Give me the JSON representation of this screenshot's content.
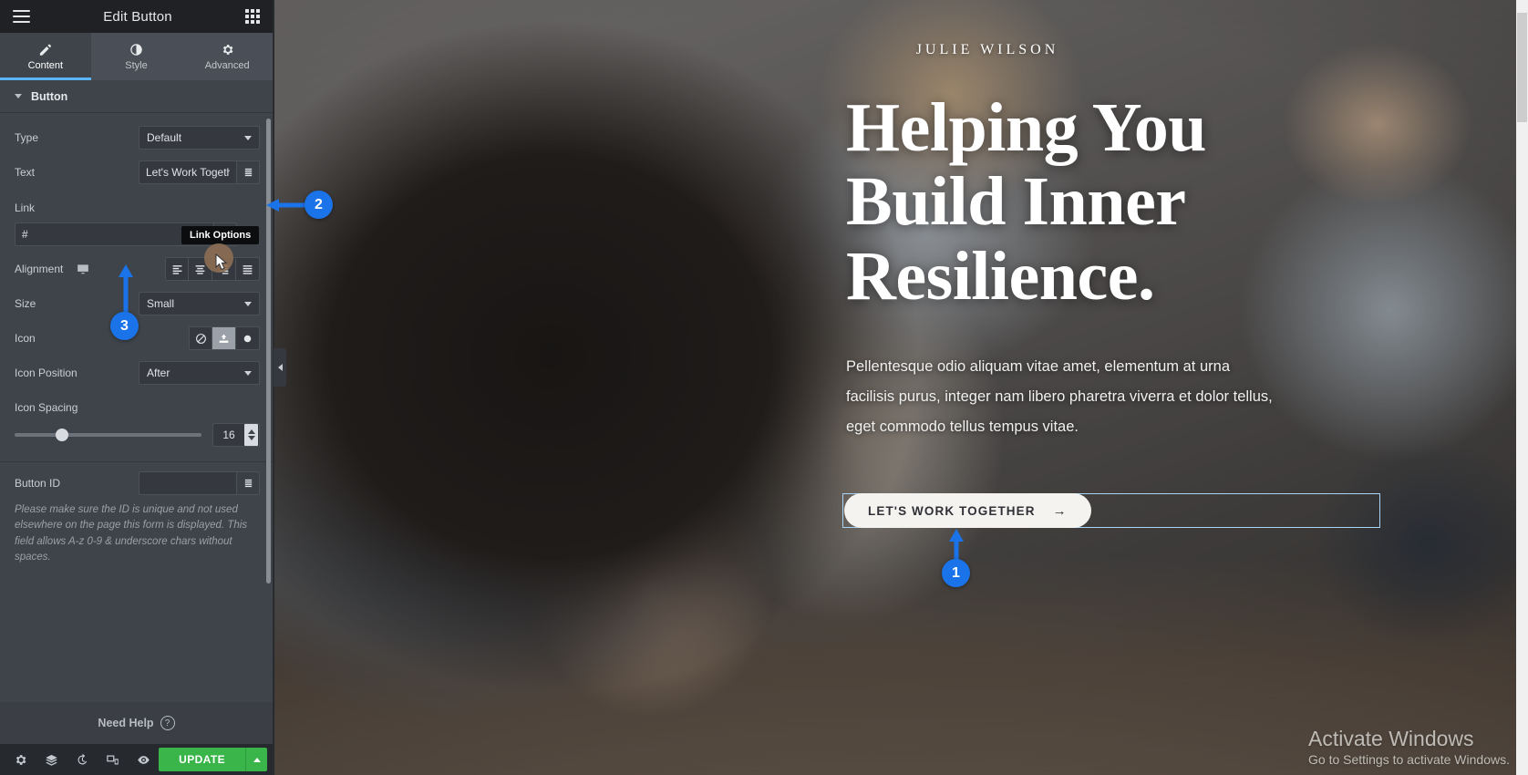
{
  "panel": {
    "header": {
      "title": "Edit Button",
      "menu_icon": "hamburger-icon",
      "apps_icon": "grid-apps-icon"
    },
    "tabs": [
      {
        "id": "content",
        "label": "Content",
        "icon": "pencil-icon",
        "active": true
      },
      {
        "id": "style",
        "label": "Style",
        "icon": "contrast-half-circle-icon",
        "active": false
      },
      {
        "id": "advanced",
        "label": "Advanced",
        "icon": "gear-icon",
        "active": false
      }
    ],
    "section": {
      "title": "Button",
      "collapse_icon": "caret-down-icon"
    },
    "controls": {
      "type": {
        "label": "Type",
        "value": "Default"
      },
      "text": {
        "label": "Text",
        "value": "Let's Work Togethe",
        "dynamic_icon": "dynamic-tags-icon"
      },
      "link": {
        "label": "Link",
        "value": "#",
        "placeholder": "",
        "dynamic_icon": "dynamic-tags-icon",
        "tooltip": "Link Options"
      },
      "alignment": {
        "label": "Alignment",
        "device_icon": "desktop-icon",
        "options": [
          "align-left",
          "align-center",
          "align-right",
          "align-justify"
        ],
        "selected": ""
      },
      "size": {
        "label": "Size",
        "value": "Small"
      },
      "icon": {
        "label": "Icon",
        "options": [
          "none-icon",
          "media-upload-icon",
          "circle-filled-icon"
        ],
        "selected_index": 1
      },
      "icon_position": {
        "label": "Icon Position",
        "value": "After"
      },
      "icon_spacing": {
        "label": "Icon Spacing",
        "value": "16"
      },
      "button_id": {
        "label": "Button ID",
        "value": "",
        "dynamic_icon": "dynamic-tags-icon",
        "help": "Please make sure the ID is unique and not used elsewhere on the page this form is displayed. This field allows A-z 0-9 & underscore chars without spaces."
      }
    },
    "need_help": {
      "label": "Need Help",
      "icon": "question-circle-icon"
    },
    "footer": {
      "buttons": [
        {
          "name": "settings",
          "icon": "gear-icon"
        },
        {
          "name": "navigator",
          "icon": "layers-icon"
        },
        {
          "name": "history",
          "icon": "history-revert-icon"
        },
        {
          "name": "responsive-mode",
          "icon": "responsive-devices-icon"
        },
        {
          "name": "preview-changes",
          "icon": "eye-icon"
        }
      ],
      "update_label": "UPDATE",
      "update_caret_icon": "caret-up-icon",
      "update_color": "#39b54a"
    },
    "collapse_handle_icon": "chevron-left-icon"
  },
  "canvas": {
    "eyebrow": "JULIE WILSON",
    "headline_lines": [
      "Helping You",
      "Build Inner",
      "Resilience."
    ],
    "subcopy": "Pellentesque odio aliquam vitae amet, elementum at urna facilisis purus, integer nam libero pharetra viverra et dolor tellus, eget commodo tellus tempus vitae.",
    "cta": {
      "label": "LET'S WORK TOGETHER",
      "arrow_icon": "arrow-right-icon"
    },
    "watermark": {
      "line1": "Activate Windows",
      "line2": "Go to Settings to activate Windows."
    }
  },
  "callouts": [
    {
      "id": 1,
      "number": "1"
    },
    {
      "id": 2,
      "number": "2"
    },
    {
      "id": 3,
      "number": "3"
    }
  ],
  "colors": {
    "accent": "#1a73e8",
    "tab_underline": "#5bb4f7",
    "panel_bg": "#3f444b",
    "update": "#39b54a"
  }
}
